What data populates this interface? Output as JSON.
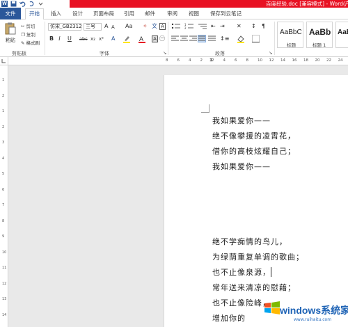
{
  "window": {
    "title": "百度经验.doc [兼容模式] - Word(产品"
  },
  "tabs": [
    {
      "label": "文件"
    },
    {
      "label": "开始"
    },
    {
      "label": "插入"
    },
    {
      "label": "设计"
    },
    {
      "label": "页面布局"
    },
    {
      "label": "引用"
    },
    {
      "label": "邮件"
    },
    {
      "label": "审阅"
    },
    {
      "label": "视图"
    },
    {
      "label": "保存到云笔记"
    }
  ],
  "clipboard": {
    "paste": "粘贴",
    "cut": "剪切",
    "copy": "复制",
    "format_painter": "格式刷",
    "group_label": "剪贴板"
  },
  "font": {
    "name": "仿宋_GB2312",
    "size": "三号",
    "bold": "B",
    "italic": "I",
    "underline": "U",
    "strikethrough": "abc",
    "subscript": "x₂",
    "superscript": "x²",
    "grow": "A",
    "shrink": "A",
    "case": "Aa",
    "group_label": "字体"
  },
  "paragraph": {
    "group_label": "段落"
  },
  "styles": [
    {
      "sample": "AaBbC",
      "name": "标题"
    },
    {
      "sample": "AaBb",
      "name": "标题 1"
    },
    {
      "sample": "AaBb",
      "name": ""
    }
  ],
  "ruler": {
    "h_ticks": [
      "8",
      "6",
      "4",
      "2",
      "2",
      "4",
      "6",
      "8",
      "10",
      "12",
      "14",
      "16",
      "18",
      "20",
      "22",
      "24",
      "26"
    ],
    "v_ticks": [
      "1",
      "2",
      "1",
      "2",
      "3",
      "4",
      "5",
      "6",
      "7",
      "8",
      "9",
      "10",
      "11",
      "12",
      "13",
      "14"
    ]
  },
  "document": {
    "lines": [
      "我如果爱你——",
      "绝不像攀援的凌霄花，",
      "借你的高枝炫耀自己；",
      "我如果爱你——",
      "绝不学痴情的鸟儿，",
      "为绿荫重复单调的歌曲；",
      "也不止像泉源，",
      "常年送来清凉的慰藉；",
      "也不止像险峰，",
      "增加你的"
    ]
  },
  "watermark": {
    "text": "windows系统家园",
    "sub": "www.ruihaitu.com"
  },
  "colors": {
    "accent": "#2b579a",
    "title_red": "#e81123"
  }
}
